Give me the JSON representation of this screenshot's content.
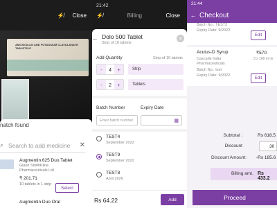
{
  "scanner": {
    "flash_icon": "flash-off-icon",
    "close_label": "Close",
    "box_text": "AMOXICILLIN AND POTASSIUM CLAVULANATE TABLETS IP",
    "match_text": "natch found",
    "search_placeholder": "Search to add medicine",
    "medicines": [
      {
        "name": "Augmentin 625 Duo Tablet",
        "mfr": "Glaxo SmithKline Pharmaceuticals Ltd",
        "price": "₹ 201.71",
        "pack": "10 tablets in 1 strip",
        "select_label": "Select"
      },
      {
        "name": "Augmentin Duo Oral",
        "mfr": "",
        "price": "",
        "pack": "",
        "select_label": ""
      }
    ]
  },
  "billing_sheet": {
    "status_time": "21:42",
    "header_title": "Billing",
    "close_label": "Close",
    "product_title": "Dolo 500 Tablet",
    "product_sub": "Strip of 10 tablets",
    "add_quantity_label": "Add Quantity",
    "strip_info": "Strip of 10 tablets",
    "qty_strip": {
      "minus": "-",
      "value": "4",
      "plus": "+",
      "unit": "Strip"
    },
    "qty_tablet": {
      "minus": "-",
      "value": "2",
      "plus": "+",
      "unit": "Tablets"
    },
    "batch_number_label": "Batch Number",
    "expiry_date_label": "Expiry Date",
    "batch_placeholder": "Enter batch number",
    "batches": [
      {
        "name": "TEST4",
        "date": "September 2022",
        "selected": false
      },
      {
        "name": "TEST9",
        "date": "September 2022",
        "selected": true
      },
      {
        "name": "TEST8",
        "date": "April 2026",
        "selected": false
      }
    ],
    "price": "Rs 64.22",
    "add_label": "Add"
  },
  "checkout": {
    "status_time": "21:44",
    "title": "Checkout",
    "item1": {
      "batch": "Batch No.: TEST3",
      "expiry": "Expiry Date: 9/2022",
      "edit_label": "Edit"
    },
    "item2": {
      "name": "Acutus-D Syrup",
      "price": "₹570",
      "mfr": "Cascade India Pharmaceuticals",
      "qty": "3 x 100 ml in",
      "batch": "Batch No.: test",
      "expiry": "Expiry Date: 9/2022",
      "edit_label": "Edit"
    },
    "subtotal_label": "Subtotal :",
    "subtotal_value": "Rs 618.5",
    "discount_label": "Discount",
    "discount_value": "30",
    "discount_amount_label": "Discount Amount:",
    "discount_amount_value": "-Rs 185.6",
    "billing_label": "Billing amt.",
    "billing_value": "Rs 433.2",
    "proceed_label": "Proceed"
  }
}
